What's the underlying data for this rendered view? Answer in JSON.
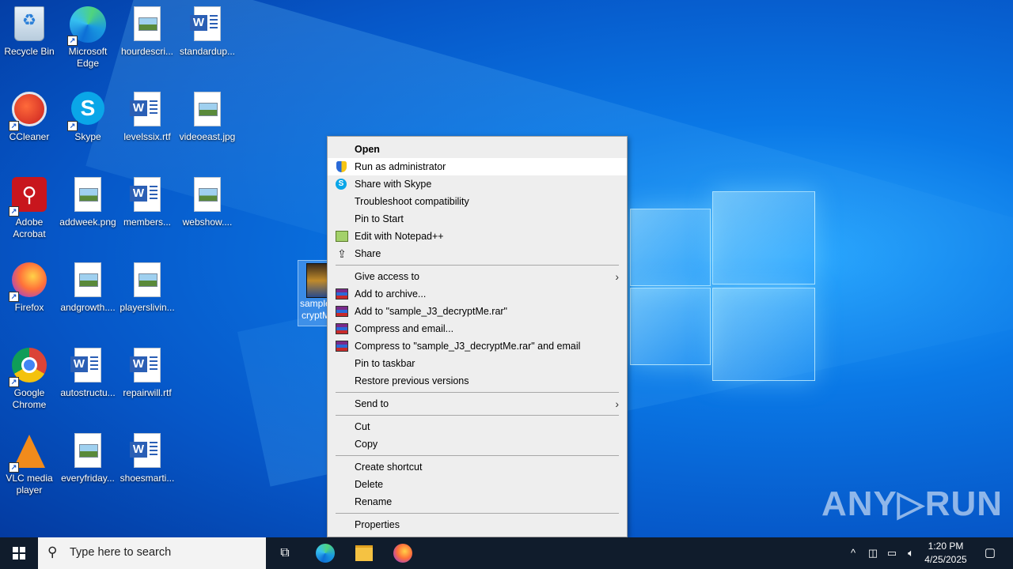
{
  "desktop": {
    "icons": [
      {
        "label": "Recycle Bin",
        "icon": "recycle-bin-icon"
      },
      {
        "label": "Microsoft Edge",
        "icon": "edge-icon"
      },
      {
        "label": "hourdescri...",
        "icon": "image-file-icon"
      },
      {
        "label": "standardup...",
        "icon": "word-document-icon"
      },
      {
        "label": "CCleaner",
        "icon": "ccleaner-icon"
      },
      {
        "label": "Skype",
        "icon": "skype-icon"
      },
      {
        "label": "levelssix.rtf",
        "icon": "word-document-icon"
      },
      {
        "label": "videoeast.jpg",
        "icon": "image-file-icon"
      },
      {
        "label": "Adobe Acrobat",
        "icon": "acrobat-icon"
      },
      {
        "label": "addweek.png",
        "icon": "image-file-icon"
      },
      {
        "label": "members...",
        "icon": "word-document-icon"
      },
      {
        "label": "webshow....",
        "icon": "image-file-icon"
      },
      {
        "label": "Firefox",
        "icon": "firefox-icon"
      },
      {
        "label": "andgrowth....",
        "icon": "image-file-icon"
      },
      {
        "label": "playerslivin...",
        "icon": "image-file-icon"
      },
      {
        "label": "Google Chrome",
        "icon": "chrome-icon"
      },
      {
        "label": "autostructu...",
        "icon": "word-document-icon"
      },
      {
        "label": "repairwill.rtf",
        "icon": "word-document-icon"
      },
      {
        "label": "VLC media player",
        "icon": "vlc-icon"
      },
      {
        "label": "everyfriday...",
        "icon": "image-file-icon"
      },
      {
        "label": "shoesmarti...",
        "icon": "word-document-icon"
      }
    ],
    "selected_file": {
      "label_line1": "sample_",
      "label_line2": "cryptM"
    }
  },
  "context_menu": {
    "items": [
      {
        "label": "Open",
        "bold": true
      },
      {
        "label": "Run as administrator",
        "icon": "uac-shield-icon"
      },
      {
        "label": "Share with Skype",
        "icon": "skype-icon"
      },
      {
        "label": "Troubleshoot compatibility"
      },
      {
        "label": "Pin to Start"
      },
      {
        "label": "Edit with Notepad++",
        "icon": "notepadpp-icon"
      },
      {
        "label": "Share",
        "icon": "share-icon"
      },
      {
        "label": "Give access to",
        "submenu": true
      },
      {
        "label": "Add to archive...",
        "icon": "winrar-icon"
      },
      {
        "label": "Add to \"sample_J3_decryptMe.rar\"",
        "icon": "winrar-icon"
      },
      {
        "label": "Compress and email...",
        "icon": "winrar-icon"
      },
      {
        "label": "Compress to \"sample_J3_decryptMe.rar\" and email",
        "icon": "winrar-icon"
      },
      {
        "label": "Pin to taskbar"
      },
      {
        "label": "Restore previous versions"
      },
      {
        "label": "Send to",
        "submenu": true
      },
      {
        "label": "Cut"
      },
      {
        "label": "Copy"
      },
      {
        "label": "Create shortcut"
      },
      {
        "label": "Delete"
      },
      {
        "label": "Rename"
      },
      {
        "label": "Properties"
      }
    ],
    "hovered": "Run as administrator"
  },
  "watermark": "ANY▷RUN",
  "taskbar": {
    "search_placeholder": "Type here to search",
    "pinned": [
      "task-view-icon",
      "edge-icon",
      "file-explorer-icon",
      "firefox-icon"
    ],
    "tray_icons": [
      "chevron-up-icon",
      "meet-now-icon",
      "network-icon",
      "volume-icon"
    ],
    "time": "1:20 PM",
    "date": "4/25/2025"
  }
}
